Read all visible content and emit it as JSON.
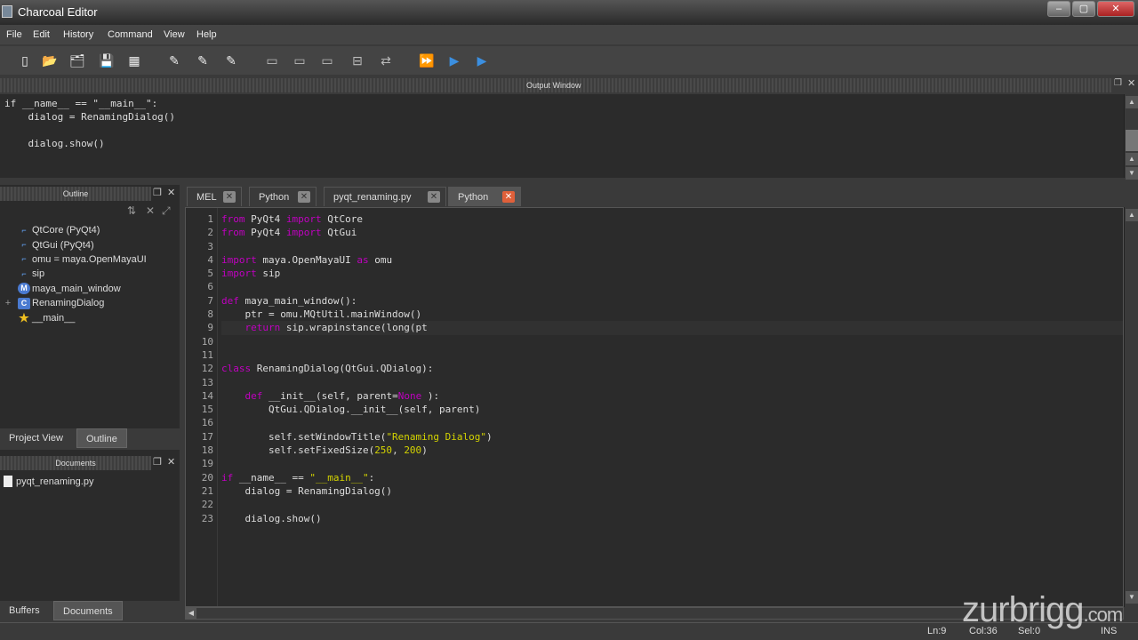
{
  "window": {
    "title": "Charcoal Editor",
    "minimize": "–",
    "maximize": "▢",
    "close": "✕"
  },
  "menu": [
    "File",
    "Edit",
    "History",
    "Command",
    "View",
    "Help"
  ],
  "toolbar_icons": [
    "new-file-icon",
    "open-file-icon",
    "open-folder-icon",
    "save-icon",
    "save-all-icon",
    "comment-icon",
    "uncomment-icon",
    "toggle-comment-icon",
    "split-top-icon",
    "split-middle-icon",
    "split-bottom-icon",
    "goto-line-icon",
    "swap-icon",
    "execute-all-icon",
    "execute-icon",
    "execute-line-icon"
  ],
  "output": {
    "title": "Output Window",
    "text": "if __name__ == \"__main__\":\n    dialog = RenamingDialog()\n\n    dialog.show()"
  },
  "outline": {
    "title": "Outline",
    "items": [
      {
        "label": "QtCore (PyQt4)",
        "icon": "import"
      },
      {
        "label": "QtGui (PyQt4)",
        "icon": "import"
      },
      {
        "label": "omu = maya.OpenMayaUI",
        "icon": "import"
      },
      {
        "label": "sip",
        "icon": "import"
      },
      {
        "label": "maya_main_window",
        "icon": "M"
      },
      {
        "label": "RenamingDialog",
        "icon": "C",
        "expand": "+"
      },
      {
        "label": "__main__",
        "icon": "star"
      }
    ],
    "tabs": [
      "Project View",
      "Outline"
    ]
  },
  "documents": {
    "title": "Documents",
    "items": [
      "pyqt_renaming.py"
    ],
    "tabs": [
      "Buffers",
      "Documents"
    ]
  },
  "editor_tabs": [
    {
      "label": "MEL"
    },
    {
      "label": "Python"
    },
    {
      "label": "pyqt_renaming.py"
    },
    {
      "label": "Python",
      "active": true
    }
  ],
  "code": [
    [
      [
        "kw",
        "from"
      ],
      [
        "",
        "PyQt4 "
      ],
      [
        "kw",
        "import"
      ],
      [
        "",
        "QtCore"
      ]
    ],
    [
      [
        "kw",
        "from"
      ],
      [
        "",
        "PyQt4 "
      ],
      [
        "kw",
        "import"
      ],
      [
        "",
        "QtGui"
      ]
    ],
    [],
    [
      [
        "kw",
        "import"
      ],
      [
        "",
        "maya.OpenMayaUI "
      ],
      [
        "kw",
        "as"
      ],
      [
        "",
        "omu"
      ]
    ],
    [
      [
        "kw",
        "import"
      ],
      [
        "",
        "sip"
      ]
    ],
    [],
    [
      [
        "kw",
        "def"
      ],
      [
        "",
        "maya_main_window():"
      ]
    ],
    [
      [
        "",
        "    ptr = omu.MQtUtil.mainWindow()"
      ]
    ],
    [
      [
        "",
        "    "
      ],
      [
        "kw",
        "return"
      ],
      [
        "",
        "sip.wrapinstance(long(pt"
      ]
    ],
    [],
    [],
    [
      [
        "kw",
        "class"
      ],
      [
        "",
        "RenamingDialog(QtGui.QDialog):"
      ]
    ],
    [],
    [
      [
        "",
        "    "
      ],
      [
        "kw",
        "def"
      ],
      [
        "",
        "__init__(self, parent="
      ],
      [
        "kw",
        "None"
      ],
      [
        "",
        "):"
      ]
    ],
    [
      [
        "",
        "        QtGui.QDialog.__init__(self, parent)"
      ]
    ],
    [],
    [
      [
        "",
        "        self.setWindowTitle("
      ],
      [
        "str",
        "\"Renaming Dialog\""
      ],
      [
        "",
        ")"
      ]
    ],
    [
      [
        "",
        "        self.setFixedSize("
      ],
      [
        "num",
        "250"
      ],
      [
        "",
        ", "
      ],
      [
        "num",
        "200"
      ],
      [
        "",
        ")"
      ]
    ],
    [],
    [
      [
        "kw",
        "if"
      ],
      [
        "",
        "__name__ == "
      ],
      [
        "str",
        "\"__main__\""
      ],
      [
        "",
        ":"
      ]
    ],
    [
      [
        "",
        "    dialog = RenamingDialog()"
      ]
    ],
    [],
    [
      [
        "",
        "    dialog.show()"
      ]
    ]
  ],
  "current_line": 9,
  "status": {
    "line": "Ln:9",
    "col": "Col:36",
    "sel": "Sel:0",
    "mode": "INS"
  },
  "watermark": "zurbrigg.com"
}
